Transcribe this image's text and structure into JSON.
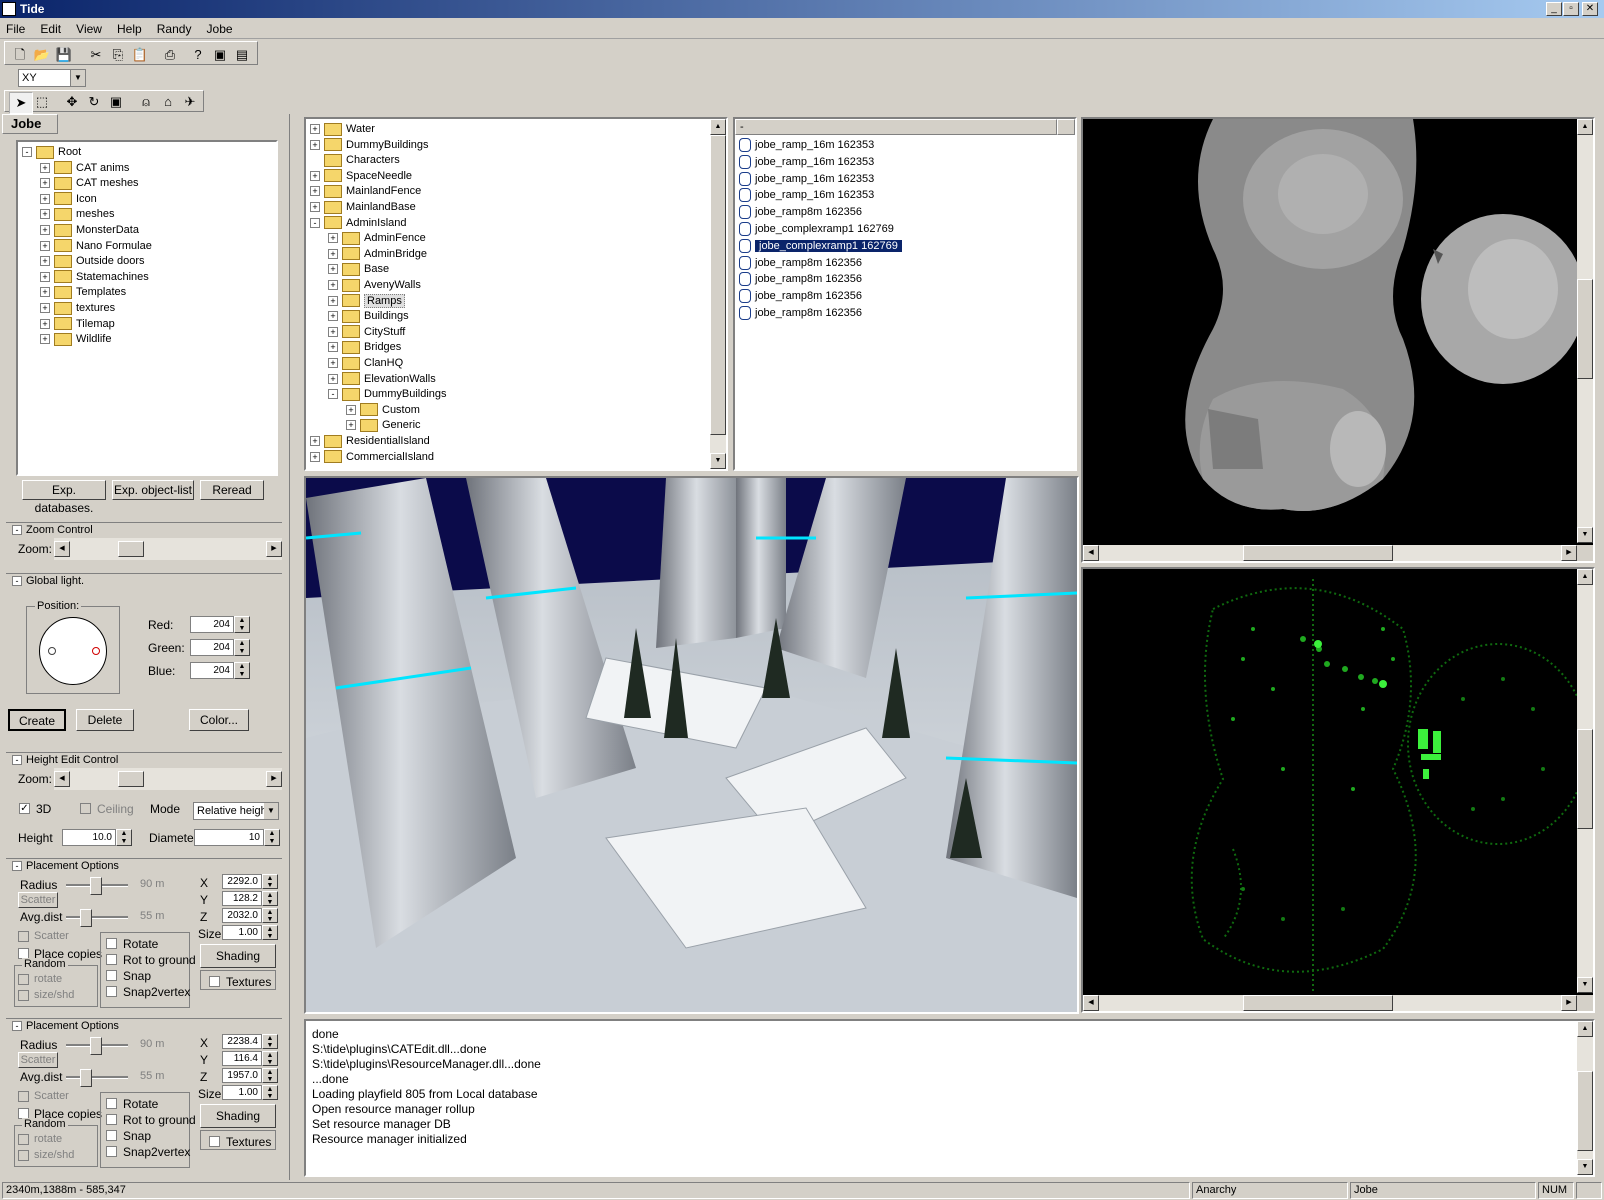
{
  "window": {
    "title": "Tide"
  },
  "menu": [
    "File",
    "Edit",
    "View",
    "Help",
    "Randy",
    "Jobe"
  ],
  "view_select": "XY",
  "panel_tab": "Jobe",
  "root_tree": [
    "Root",
    "CAT anims",
    "CAT meshes",
    "Icon",
    "meshes",
    "MonsterData",
    "Nano Formulae",
    "Outside doors",
    "Statemachines",
    "Templates",
    "textures",
    "Tilemap",
    "Wildlife"
  ],
  "buttons": {
    "exp_databases": "Exp. databases.",
    "exp_object_list": "Exp. object-list",
    "reread": "Reread",
    "create": "Create",
    "delete": "Delete",
    "color": "Color...",
    "shading": "Shading"
  },
  "zoom_control": {
    "title": "Zoom Control",
    "zoom_label": "Zoom:",
    "zoom_level": 0.3
  },
  "global_light": {
    "title": "Global light.",
    "position_label": "Position:",
    "red_label": "Red:",
    "red": "204",
    "green_label": "Green:",
    "green": "204",
    "blue_label": "Blue:",
    "blue": "204"
  },
  "height_edit": {
    "title": "Height Edit Control",
    "zoom_label": "Zoom:",
    "zoom_level": 0.3,
    "three_d": "3D",
    "ceiling": "Ceiling",
    "mode_label": "Mode",
    "mode_value": "Relative heigh",
    "height_label": "Height",
    "height": "10.0",
    "diameter_label": "Diameter",
    "diameter": "10"
  },
  "placement1": {
    "title": "Placement Options",
    "radius_label": "Radius",
    "radius": "90 m",
    "scatter_btn": "Scatter",
    "avg_label": "Avg.dist",
    "avg": "55 m",
    "scatter_chk": "Scatter",
    "place_copies": "Place copies",
    "random": "Random",
    "rotate_small": "rotate",
    "size_shd": "size/shd",
    "rotate": "Rotate",
    "rot_ground": "Rot to ground",
    "snap": "Snap",
    "snap2vertex": "Snap2vertex",
    "x_label": "X",
    "x": "2292.0",
    "y_label": "Y",
    "y": "128.2",
    "z_label": "Z",
    "z": "2032.0",
    "size_label": "Size",
    "size": "1.00",
    "shading": "Shading",
    "textures": "Textures"
  },
  "placement2": {
    "title": "Placement Options",
    "radius_label": "Radius",
    "radius": "90 m",
    "scatter_btn": "Scatter",
    "avg_label": "Avg.dist",
    "avg": "55 m",
    "scatter_chk": "Scatter",
    "place_copies": "Place copies",
    "random": "Random",
    "rotate_small": "rotate",
    "size_shd": "size/shd",
    "rotate": "Rotate",
    "rot_ground": "Rot to ground",
    "snap": "Snap",
    "snap2vertex": "Snap2vertex",
    "x_label": "X",
    "x": "2238.4",
    "y_label": "Y",
    "y": "116.4",
    "z_label": "Z",
    "z": "1957.0",
    "size_label": "Size",
    "size": "1.00",
    "shading": "Shading",
    "textures": "Textures"
  },
  "resource_tree": [
    {
      "label": "Water",
      "level": 0,
      "pm": "+"
    },
    {
      "label": "DummyBuildings",
      "level": 0,
      "pm": "+"
    },
    {
      "label": "Characters",
      "level": 0,
      "pm": ""
    },
    {
      "label": "SpaceNeedle",
      "level": 0,
      "pm": "+"
    },
    {
      "label": "MainlandFence",
      "level": 0,
      "pm": "+"
    },
    {
      "label": "MainlandBase",
      "level": 0,
      "pm": "+"
    },
    {
      "label": "AdminIsland",
      "level": 0,
      "pm": "-"
    },
    {
      "label": "AdminFence",
      "level": 1,
      "pm": "+"
    },
    {
      "label": "AdminBridge",
      "level": 1,
      "pm": "+"
    },
    {
      "label": "Base",
      "level": 1,
      "pm": "+"
    },
    {
      "label": "AvenyWalls",
      "level": 1,
      "pm": "+"
    },
    {
      "label": "Ramps",
      "level": 1,
      "pm": "+",
      "selected": true
    },
    {
      "label": "Buildings",
      "level": 1,
      "pm": "+"
    },
    {
      "label": "CityStuff",
      "level": 1,
      "pm": "+"
    },
    {
      "label": "Bridges",
      "level": 1,
      "pm": "+"
    },
    {
      "label": "ClanHQ",
      "level": 1,
      "pm": "+"
    },
    {
      "label": "ElevationWalls",
      "level": 1,
      "pm": "+"
    },
    {
      "label": "DummyBuildings",
      "level": 1,
      "pm": "-"
    },
    {
      "label": "Custom",
      "level": 2,
      "pm": "+"
    },
    {
      "label": "Generic",
      "level": 2,
      "pm": "+"
    },
    {
      "label": "ResidentialIsland",
      "level": 0,
      "pm": "+"
    },
    {
      "label": "CommercialIsland",
      "level": 0,
      "pm": "+"
    }
  ],
  "file_list_header": "-",
  "file_list": [
    "jobe_ramp_16m 162353",
    "jobe_ramp_16m 162353",
    "jobe_ramp_16m 162353",
    "jobe_ramp_16m 162353",
    "jobe_ramp8m 162356",
    "jobe_complexramp1 162769",
    "jobe_complexramp1 162769",
    "jobe_ramp8m 162356",
    "jobe_ramp8m 162356",
    "jobe_ramp8m 162356",
    "jobe_ramp8m 162356"
  ],
  "file_selected_index": 6,
  "log": [
    "done",
    "S:\\tide\\plugins\\CATEdit.dll...done",
    "S:\\tide\\plugins\\ResourceManager.dll...done",
    "...done",
    "Loading playfield 805 from Local database",
    "Open resource manager rollup",
    "Set resource manager DB",
    "Resource manager initialized"
  ],
  "status": {
    "coords": "2340m,1388m  -  585,347",
    "user": "Anarchy",
    "module": "Jobe",
    "num": "NUM"
  },
  "colors": {
    "titlebar": "#0a246a",
    "selection": "#0a246a",
    "sky": "#0b0b4a",
    "accent": "#00e5ff",
    "green_map": "#19d619"
  },
  "icons": [
    "new-icon",
    "open-icon",
    "save-icon",
    "cut-icon",
    "copy-icon",
    "paste-icon",
    "print-icon",
    "help-icon",
    "import-icon",
    "export-icon"
  ]
}
